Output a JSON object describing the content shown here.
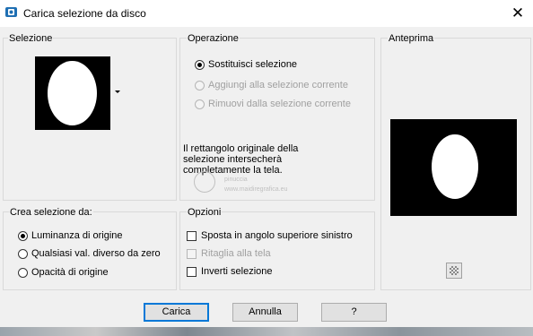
{
  "window": {
    "title": "Carica selezione da disco",
    "close_glyph": "✕"
  },
  "selezione": {
    "label": "Selezione"
  },
  "operazione": {
    "label": "Operazione",
    "options": [
      {
        "label": "Sostituisci selezione",
        "selected": true,
        "enabled": true
      },
      {
        "label": "Aggiungi alla selezione corrente",
        "selected": false,
        "enabled": false
      },
      {
        "label": "Rimuovi dalla selezione corrente",
        "selected": false,
        "enabled": false
      }
    ],
    "info_lines": [
      "Il rettangolo originale della",
      "selezione intersecherà",
      "completamente la tela."
    ]
  },
  "anteprima": {
    "label": "Anteprima"
  },
  "crea_selezione": {
    "label": "Crea selezione da:",
    "options": [
      {
        "label": "Luminanza di origine",
        "selected": true
      },
      {
        "label": "Qualsiasi val. diverso da zero",
        "selected": false
      },
      {
        "label": "Opacità di origine",
        "selected": false
      }
    ]
  },
  "opzioni": {
    "label": "Opzioni",
    "checkboxes": [
      {
        "label": "Sposta in angolo superiore sinistro",
        "checked": false,
        "enabled": true
      },
      {
        "label": "Ritaglia alla tela",
        "checked": false,
        "enabled": false
      },
      {
        "label": "Inverti selezione",
        "checked": false,
        "enabled": true
      }
    ]
  },
  "buttons": {
    "carica": "Carica",
    "annulla": "Annulla",
    "help": "?"
  },
  "watermark": {
    "line1": "pinuccia",
    "line2": "www.maidiregrafica.eu"
  },
  "icons": {
    "app": "psp-app-icon",
    "close": "close-icon",
    "zoom": "preview-zoom-icon"
  }
}
